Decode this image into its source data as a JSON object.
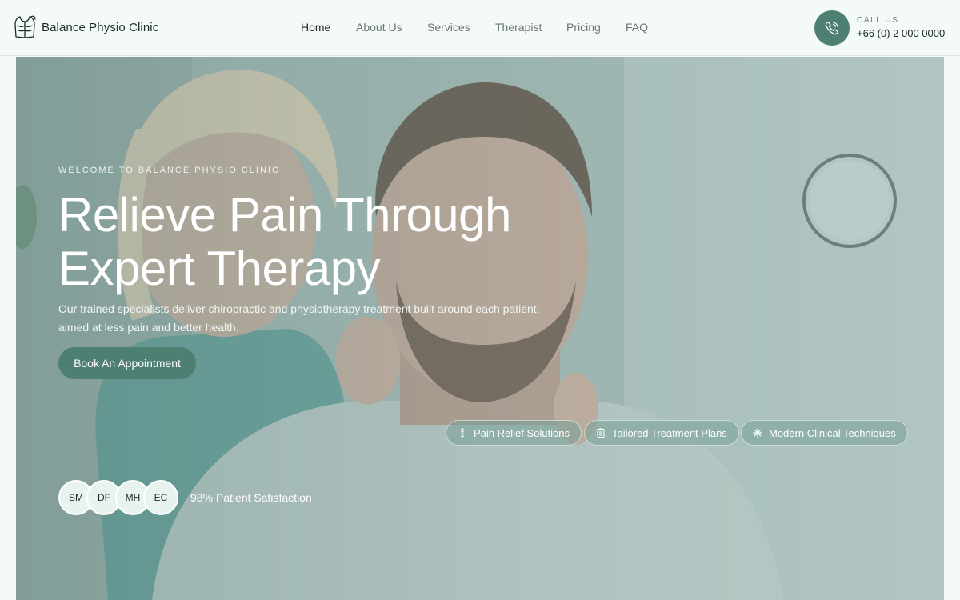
{
  "brand": {
    "name": "Balance Physio Clinic",
    "logo_icon": "physio-torso-icon"
  },
  "nav": {
    "items": [
      {
        "label": "Home",
        "active": true
      },
      {
        "label": "About Us",
        "active": false
      },
      {
        "label": "Services",
        "active": false
      },
      {
        "label": "Therapist",
        "active": false
      },
      {
        "label": "Pricing",
        "active": false
      },
      {
        "label": "FAQ",
        "active": false
      }
    ]
  },
  "contact": {
    "label": "CALL US",
    "phone": "+66 (0) 2 000 0000",
    "icon": "phone-icon"
  },
  "hero": {
    "eyebrow": "WELCOME TO BALANCE PHYSIO CLINIC",
    "headline_line1": "Relieve Pain Through",
    "headline_line2": "Expert Therapy",
    "lede": "Our trained specialists deliver chiropractic and physiotherapy treatment built around each patient, aimed at less pain and better health.",
    "cta_label": "Book An Appointment",
    "features": [
      {
        "label": "Pain Relief Solutions",
        "icon": "spine-icon"
      },
      {
        "label": "Tailored Treatment Plans",
        "icon": "clipboard-icon"
      },
      {
        "label": "Modern Clinical Techniques",
        "icon": "sparkle-icon"
      }
    ],
    "avatars": [
      "SM",
      "DF",
      "MH",
      "EC"
    ],
    "satisfaction": "98% Patient Satisfaction"
  },
  "colors": {
    "accent": "#4e7f73",
    "page_background": "#f3faf8",
    "text_dark": "#1f2a27",
    "nav_muted": "#6c7673"
  }
}
